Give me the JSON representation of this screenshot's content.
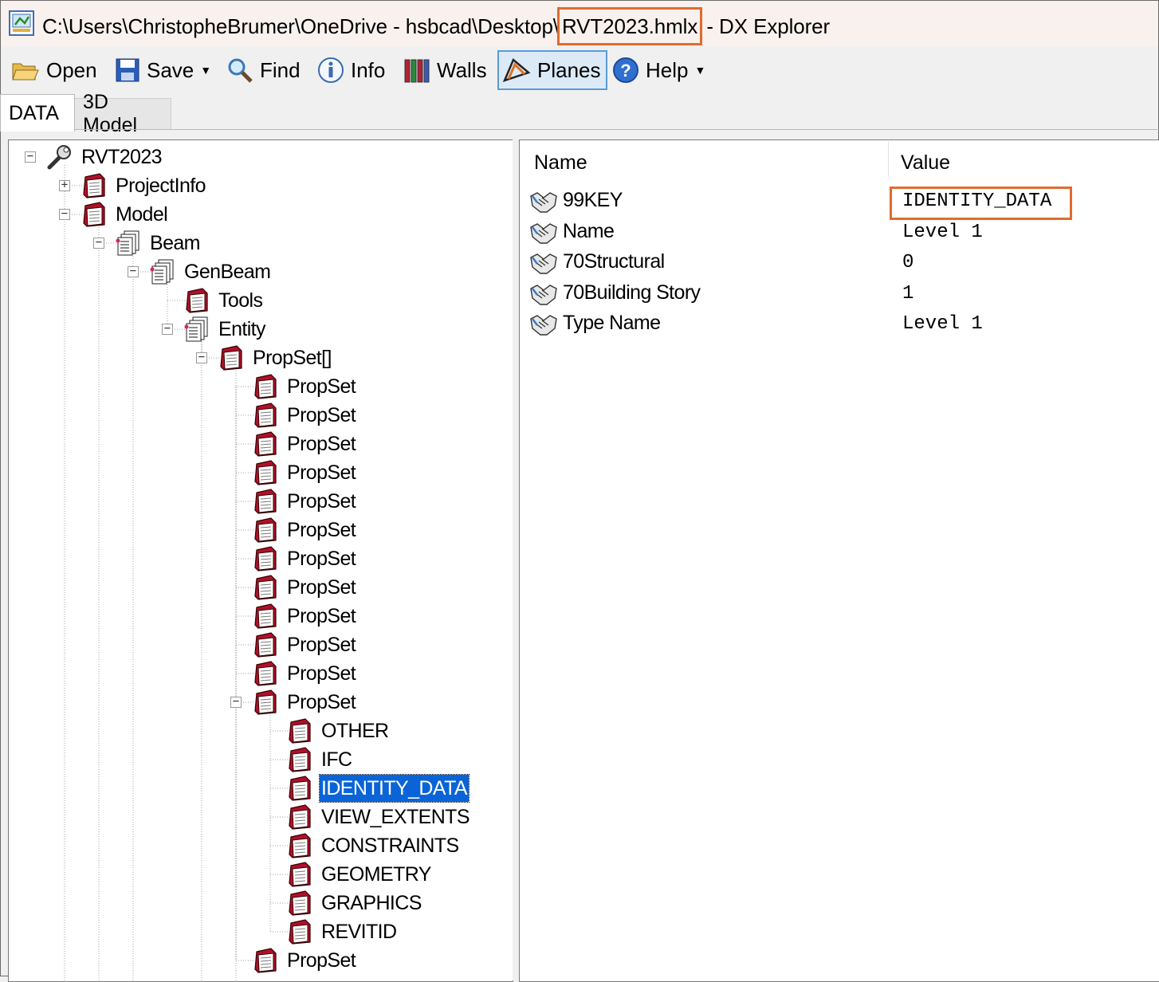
{
  "window": {
    "title_prefix": "C:\\Users\\ChristopheBrumer\\OneDrive - hsbcad\\Desktop\\",
    "title_file": "RVT2023.hmlx",
    "title_suffix": " - DX Explorer"
  },
  "toolbar": {
    "open": "Open",
    "save": "Save",
    "find": "Find",
    "info": "Info",
    "walls": "Walls",
    "planes": "Planes",
    "help": "Help"
  },
  "tabs": {
    "data": "DATA",
    "model": "3D Model"
  },
  "tree": {
    "nodes": [
      {
        "label": "RVT2023",
        "icon": "wrench-icon",
        "expander": "minus"
      },
      {
        "label": "ProjectInfo",
        "icon": "book-icon",
        "expander": "plus"
      },
      {
        "label": "Model",
        "icon": "book-icon",
        "expander": "minus"
      },
      {
        "label": "Beam",
        "icon": "document-stack-icon",
        "expander": "minus"
      },
      {
        "label": "GenBeam",
        "icon": "document-stack-icon",
        "expander": "minus"
      },
      {
        "label": "Tools",
        "icon": "book-icon",
        "expander": ""
      },
      {
        "label": "Entity",
        "icon": "document-stack-icon",
        "expander": "minus"
      },
      {
        "label": "PropSet[]",
        "icon": "book-icon",
        "expander": "minus"
      },
      {
        "label": "PropSet",
        "icon": "book-icon",
        "expander": ""
      },
      {
        "label": "PropSet",
        "icon": "book-icon",
        "expander": ""
      },
      {
        "label": "PropSet",
        "icon": "book-icon",
        "expander": ""
      },
      {
        "label": "PropSet",
        "icon": "book-icon",
        "expander": ""
      },
      {
        "label": "PropSet",
        "icon": "book-icon",
        "expander": ""
      },
      {
        "label": "PropSet",
        "icon": "book-icon",
        "expander": ""
      },
      {
        "label": "PropSet",
        "icon": "book-icon",
        "expander": ""
      },
      {
        "label": "PropSet",
        "icon": "book-icon",
        "expander": ""
      },
      {
        "label": "PropSet",
        "icon": "book-icon",
        "expander": ""
      },
      {
        "label": "PropSet",
        "icon": "book-icon",
        "expander": ""
      },
      {
        "label": "PropSet",
        "icon": "book-icon",
        "expander": ""
      },
      {
        "label": "PropSet",
        "icon": "book-icon",
        "expander": "minus"
      },
      {
        "label": "OTHER",
        "icon": "book-icon",
        "expander": ""
      },
      {
        "label": "IFC",
        "icon": "book-icon",
        "expander": ""
      },
      {
        "label": "IDENTITY_DATA",
        "icon": "book-icon",
        "expander": "",
        "selected": true
      },
      {
        "label": "VIEW_EXTENTS",
        "icon": "book-icon",
        "expander": ""
      },
      {
        "label": "CONSTRAINTS",
        "icon": "book-icon",
        "expander": ""
      },
      {
        "label": "GEOMETRY",
        "icon": "book-icon",
        "expander": ""
      },
      {
        "label": "GRAPHICS",
        "icon": "book-icon",
        "expander": ""
      },
      {
        "label": "REVITID",
        "icon": "book-icon",
        "expander": ""
      },
      {
        "label": "PropSet",
        "icon": "book-icon",
        "expander": ""
      }
    ]
  },
  "properties": {
    "columns": {
      "name": "Name",
      "value": "Value"
    },
    "rows": [
      {
        "name": "99KEY",
        "value": "IDENTITY_DATA"
      },
      {
        "name": "Name",
        "value": "Level 1"
      },
      {
        "name": "70Structural",
        "value": "0"
      },
      {
        "name": "70Building Story",
        "value": "1"
      },
      {
        "name": "Type Name",
        "value": "Level 1"
      }
    ]
  },
  "colors": {
    "highlight": "#e06b2d",
    "selection": "#0a64d8",
    "book_red": "#b0102a"
  }
}
